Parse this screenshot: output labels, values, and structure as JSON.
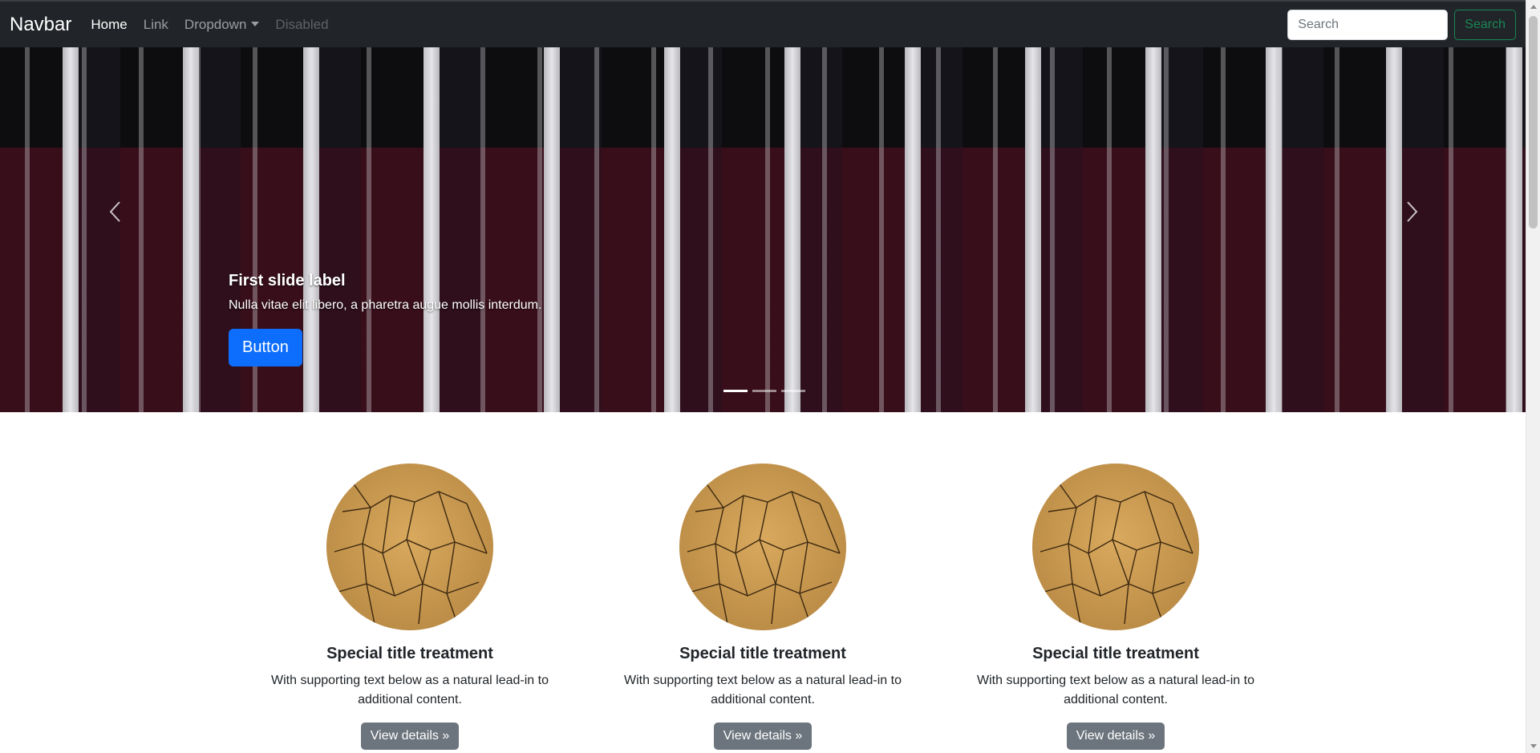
{
  "navbar": {
    "brand": "Navbar",
    "links": {
      "home": "Home",
      "link": "Link",
      "dropdown": "Dropdown",
      "disabled": "Disabled"
    },
    "search_placeholder": "Search",
    "search_button": "Search"
  },
  "carousel": {
    "caption_title": "First slide label",
    "caption_text": "Nulla vitae elit libero, a pharetra augue mollis interdum.",
    "caption_button": "Button",
    "slide_count": 3,
    "active_slide": 1
  },
  "columns": [
    {
      "title": "Special title treatment",
      "text": "With supporting text below as a natural lead-in to additional content.",
      "button": "View details »"
    },
    {
      "title": "Special title treatment",
      "text": "With supporting text below as a natural lead-in to additional content.",
      "button": "View details »"
    },
    {
      "title": "Special title treatment",
      "text": "With supporting text below as a natural lead-in to additional content.",
      "button": "View details »"
    }
  ],
  "colors": {
    "navbar_bg": "#212529",
    "primary": "#0d6efd",
    "success": "#198754",
    "secondary": "#6c757d"
  }
}
